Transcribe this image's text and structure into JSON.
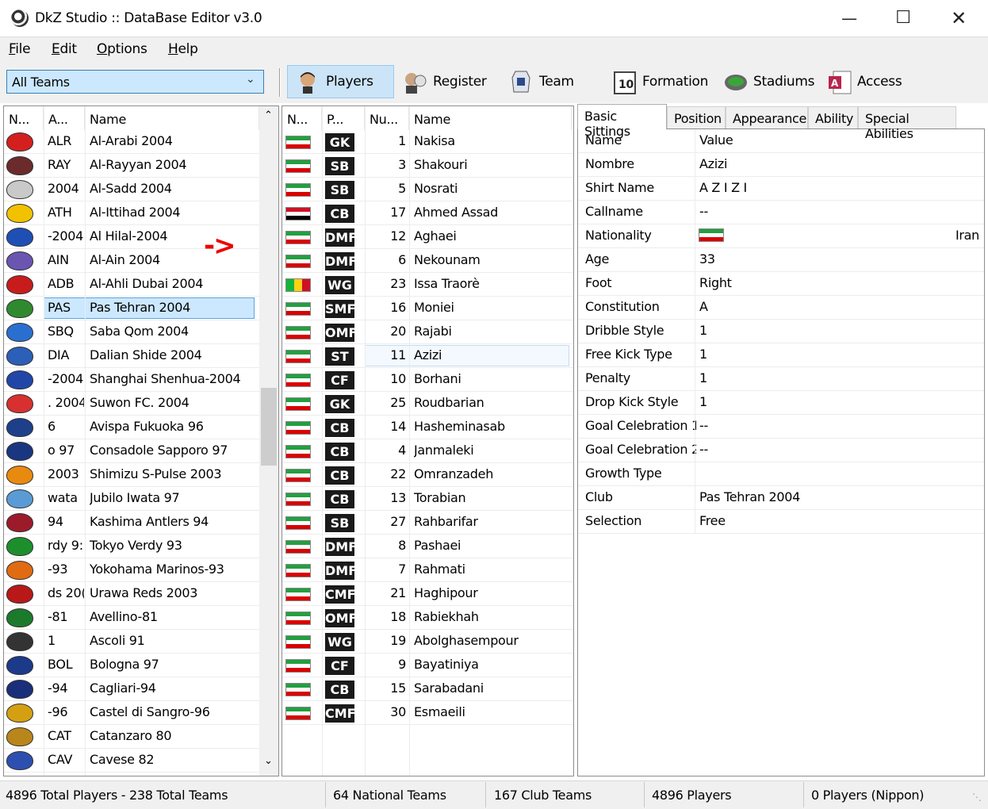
{
  "window": {
    "title": "DkZ Studio :: DataBase Editor v3.0"
  },
  "menu": [
    "File",
    "Edit",
    "Options",
    "Help"
  ],
  "toolbar": {
    "team_filter": "All Teams",
    "buttons": [
      {
        "label": "Players",
        "icon": "player-face-icon",
        "active": true
      },
      {
        "label": "Register",
        "icon": "register-icon"
      },
      {
        "label": "Team",
        "icon": "team-jersey-icon"
      },
      {
        "label": "Formation",
        "icon": "formation-board-icon"
      },
      {
        "label": "Stadiums",
        "icon": "stadium-icon"
      },
      {
        "label": "Access",
        "icon": "access-database-icon"
      }
    ]
  },
  "teams": {
    "columns": [
      "N...",
      "A...",
      "Name"
    ],
    "selected_index": 7,
    "rows": [
      {
        "abbr": "ALR",
        "name": "Al-Arabi 2004",
        "color": "#d41f1f"
      },
      {
        "abbr": "RAY",
        "name": "Al-Rayyan 2004",
        "color": "#6b2b2b"
      },
      {
        "abbr": "2004",
        "name": "Al-Sadd 2004",
        "color": "#c9c9c9"
      },
      {
        "abbr": "ATH",
        "name": "Al-Ittihad 2004",
        "color": "#f2c200"
      },
      {
        "abbr": "-2004",
        "name": "Al Hilal-2004",
        "color": "#1f4fb5"
      },
      {
        "abbr": "AIN",
        "name": "Al-Ain 2004",
        "color": "#6a55b0"
      },
      {
        "abbr": "ADB",
        "name": "Al-Ahli Dubai 2004",
        "color": "#c81c1c"
      },
      {
        "abbr": "PAS",
        "name": "Pas Tehran 2004",
        "color": "#2f8a2f"
      },
      {
        "abbr": "SBQ",
        "name": "Saba Qom 2004",
        "color": "#2a6fd0"
      },
      {
        "abbr": "DIA",
        "name": "Dalian Shide 2004",
        "color": "#2c5fb8"
      },
      {
        "abbr": "-2004",
        "name": "Shanghai Shenhua-2004",
        "color": "#2046a8"
      },
      {
        "abbr": ". 2004",
        "name": "Suwon FC. 2004",
        "color": "#d83030"
      },
      {
        "abbr": "6",
        "name": "Avispa Fukuoka 96",
        "color": "#1e3f8a"
      },
      {
        "abbr": "o 97",
        "name": "Consadole Sapporo 97",
        "color": "#1a3680"
      },
      {
        "abbr": "2003",
        "name": "Shimizu S-Pulse 2003",
        "color": "#e88a10"
      },
      {
        "abbr": "wata",
        "name": "Jubilo Iwata 97",
        "color": "#5a9bd5"
      },
      {
        "abbr": "94",
        "name": "Kashima Antlers 94",
        "color": "#9b1b2b"
      },
      {
        "abbr": "rdy 9:",
        "name": "Tokyo Verdy 93",
        "color": "#1c8f2c"
      },
      {
        "abbr": "-93",
        "name": "Yokohama Marinos-93",
        "color": "#e06b12"
      },
      {
        "abbr": "ds 20(",
        "name": "Urawa Reds 2003",
        "color": "#b81818"
      },
      {
        "abbr": "-81",
        "name": "Avellino-81",
        "color": "#1c7a2c"
      },
      {
        "abbr": "1",
        "name": "Ascoli 91",
        "color": "#333333"
      },
      {
        "abbr": "BOL",
        "name": "Bologna 97",
        "color": "#1c3a8a"
      },
      {
        "abbr": "-94",
        "name": "Cagliari-94",
        "color": "#1a2f7a"
      },
      {
        "abbr": "-96",
        "name": "Castel di Sangro-96",
        "color": "#d4a012"
      },
      {
        "abbr": "CAT",
        "name": "Catanzaro 80",
        "color": "#b8861a"
      },
      {
        "abbr": "CAV",
        "name": "Cavese 82",
        "color": "#2d4fb0"
      }
    ]
  },
  "annotation": {
    "arrow": "->"
  },
  "players": {
    "columns": [
      "N...",
      "P...",
      "Nu...",
      "Name"
    ],
    "selected_index": 9,
    "rows": [
      {
        "flag": "iran",
        "pos": "GK",
        "num": "1",
        "name": "Nakisa"
      },
      {
        "flag": "iran",
        "pos": "SB",
        "num": "3",
        "name": "Shakouri"
      },
      {
        "flag": "iran",
        "pos": "SB",
        "num": "5",
        "name": "Nosrati"
      },
      {
        "flag": "iraq",
        "pos": "CB",
        "num": "17",
        "name": "Ahmed Assad"
      },
      {
        "flag": "iran",
        "pos": "DMF",
        "num": "12",
        "name": "Aghaei"
      },
      {
        "flag": "iran",
        "pos": "DMF",
        "num": "6",
        "name": "Nekounam"
      },
      {
        "flag": "mali",
        "pos": "WG",
        "num": "23",
        "name": "Issa Traorè"
      },
      {
        "flag": "iran",
        "pos": "SMF",
        "num": "16",
        "name": "Moniei"
      },
      {
        "flag": "iran",
        "pos": "OMF",
        "num": "20",
        "name": "Rajabi"
      },
      {
        "flag": "iran",
        "pos": "ST",
        "num": "11",
        "name": "Azizi"
      },
      {
        "flag": "iran",
        "pos": "CF",
        "num": "10",
        "name": "Borhani"
      },
      {
        "flag": "iran",
        "pos": "GK",
        "num": "25",
        "name": "Roudbarian"
      },
      {
        "flag": "iran",
        "pos": "CB",
        "num": "14",
        "name": "Hasheminasab"
      },
      {
        "flag": "iran",
        "pos": "CB",
        "num": "4",
        "name": "Janmaleki"
      },
      {
        "flag": "iran",
        "pos": "CB",
        "num": "22",
        "name": "Omranzadeh"
      },
      {
        "flag": "iran",
        "pos": "CB",
        "num": "13",
        "name": "Torabian"
      },
      {
        "flag": "iran",
        "pos": "SB",
        "num": "27",
        "name": "Rahbarifar"
      },
      {
        "flag": "iran",
        "pos": "DMF",
        "num": "8",
        "name": "Pashaei"
      },
      {
        "flag": "iran",
        "pos": "DMF",
        "num": "7",
        "name": "Rahmati"
      },
      {
        "flag": "iran",
        "pos": "CMF",
        "num": "21",
        "name": "Haghipour"
      },
      {
        "flag": "iran",
        "pos": "OMF",
        "num": "18",
        "name": "Rabiekhah"
      },
      {
        "flag": "iran",
        "pos": "WG",
        "num": "19",
        "name": "Abolghasempour"
      },
      {
        "flag": "iran",
        "pos": "CF",
        "num": "9",
        "name": "Bayatiniya"
      },
      {
        "flag": "iran",
        "pos": "CB",
        "num": "15",
        "name": "Sarabadani"
      },
      {
        "flag": "iran",
        "pos": "CMF",
        "num": "30",
        "name": "Esmaeili"
      }
    ]
  },
  "details": {
    "tabs": [
      "Basic Sittings",
      "Position",
      "Appearance",
      "Ability",
      "Special Abilities"
    ],
    "active_tab": 0,
    "rows": [
      {
        "label": "Name",
        "value": "Value"
      },
      {
        "label": "Nombre",
        "value": "Azizi"
      },
      {
        "label": "Shirt Name",
        "value": "A Z I Z I"
      },
      {
        "label": "Callname",
        "value": "--"
      },
      {
        "label": "Nationality",
        "value": "Iran",
        "flag": "iran"
      },
      {
        "label": "Age",
        "value": "33"
      },
      {
        "label": "Foot",
        "value": "Right"
      },
      {
        "label": "Constitution",
        "value": "A"
      },
      {
        "label": "Dribble Style",
        "value": "1"
      },
      {
        "label": "Free Kick Type",
        "value": "1"
      },
      {
        "label": "Penalty",
        "value": "1"
      },
      {
        "label": "Drop Kick Style",
        "value": "1"
      },
      {
        "label": "Goal Celebration 1",
        "value": "--"
      },
      {
        "label": "Goal Celebration 2",
        "value": "--"
      },
      {
        "label": "Growth Type",
        "value": ""
      },
      {
        "label": "Club",
        "value": "Pas Tehran 2004"
      },
      {
        "label": "Selection",
        "value": "Free"
      }
    ]
  },
  "status": {
    "totals": "4896 Total Players  -  238 Total Teams",
    "national": "64 National Teams",
    "club": "167 Club Teams",
    "players": "4896 Players",
    "nippon": "0 Players (Nippon)"
  }
}
